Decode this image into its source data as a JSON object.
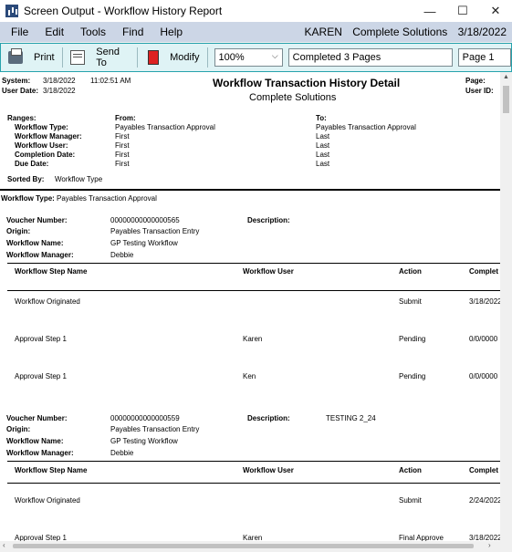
{
  "window": {
    "title": "Screen Output - Workflow History Report",
    "minimize": "—",
    "maximize": "☐",
    "close": "✕"
  },
  "menu": {
    "items": [
      "File",
      "Edit",
      "Tools",
      "Find",
      "Help"
    ],
    "user": "KAREN",
    "company": "Complete Solutions",
    "date": "3/18/2022"
  },
  "toolbar": {
    "print": "Print",
    "send_to": "Send To",
    "modify": "Modify",
    "zoom": "100%",
    "status": "Completed 3 Pages",
    "page": "Page 1"
  },
  "report": {
    "system_label": "System:",
    "system_date": "3/18/2022",
    "system_time": "11:02:51 AM",
    "user_date_label": "User Date:",
    "user_date": "3/18/2022",
    "title": "Workflow Transaction History Detail",
    "company": "Complete Solutions",
    "page_label": "Page:",
    "userid_label": "User ID:",
    "ranges_label": "Ranges:",
    "from_label": "From:",
    "to_label": "To:",
    "ranges": [
      {
        "label": "Workflow Type:",
        "from": "Payables Transaction Approval",
        "to": "Payables Transaction Approval"
      },
      {
        "label": "Workflow Manager:",
        "from": "First",
        "to": "Last"
      },
      {
        "label": "Workflow User:",
        "from": "First",
        "to": "Last"
      },
      {
        "label": "Completion Date:",
        "from": "First",
        "to": "Last"
      },
      {
        "label": "Due Date:",
        "from": "First",
        "to": "Last"
      }
    ],
    "sorted_by_label": "Sorted By:",
    "sorted_by": "Workflow Type",
    "workflow_type_label": "Workflow Type:",
    "workflow_type": "Payables Transaction Approval",
    "voucher_label": "Voucher Number:",
    "origin_label": "Origin:",
    "wf_name_label": "Workflow Name:",
    "wf_manager_label": "Workflow Manager:",
    "description_label": "Description:",
    "col_step": "Workflow Step Name",
    "col_user": "Workflow User",
    "col_action": "Action",
    "col_complete": "Complet",
    "vouchers": [
      {
        "number": "00000000000000565",
        "origin": "Payables Transaction Entry",
        "wf_name": "GP Testing Workflow",
        "manager": "Debbie",
        "description": "",
        "steps": [
          {
            "step": "Workflow Originated",
            "user": "",
            "action": "Submit",
            "date": "3/18/2022"
          },
          {
            "step": "Approval Step 1",
            "user": "Karen",
            "action": "Pending",
            "date": "0/0/0000"
          },
          {
            "step": "Approval Step 1",
            "user": "Ken",
            "action": "Pending",
            "date": "0/0/0000"
          }
        ]
      },
      {
        "number": "00000000000000559",
        "origin": "Payables Transaction Entry",
        "wf_name": "GP Testing Workflow",
        "manager": "Debbie",
        "description": "TESTING 2_24",
        "steps": [
          {
            "step": "Workflow Originated",
            "user": "",
            "action": "Submit",
            "date": "2/24/2022"
          },
          {
            "step": "Approval Step 1",
            "user": "Karen",
            "action": "Final Approve",
            "date": "3/18/2022"
          }
        ]
      }
    ]
  }
}
